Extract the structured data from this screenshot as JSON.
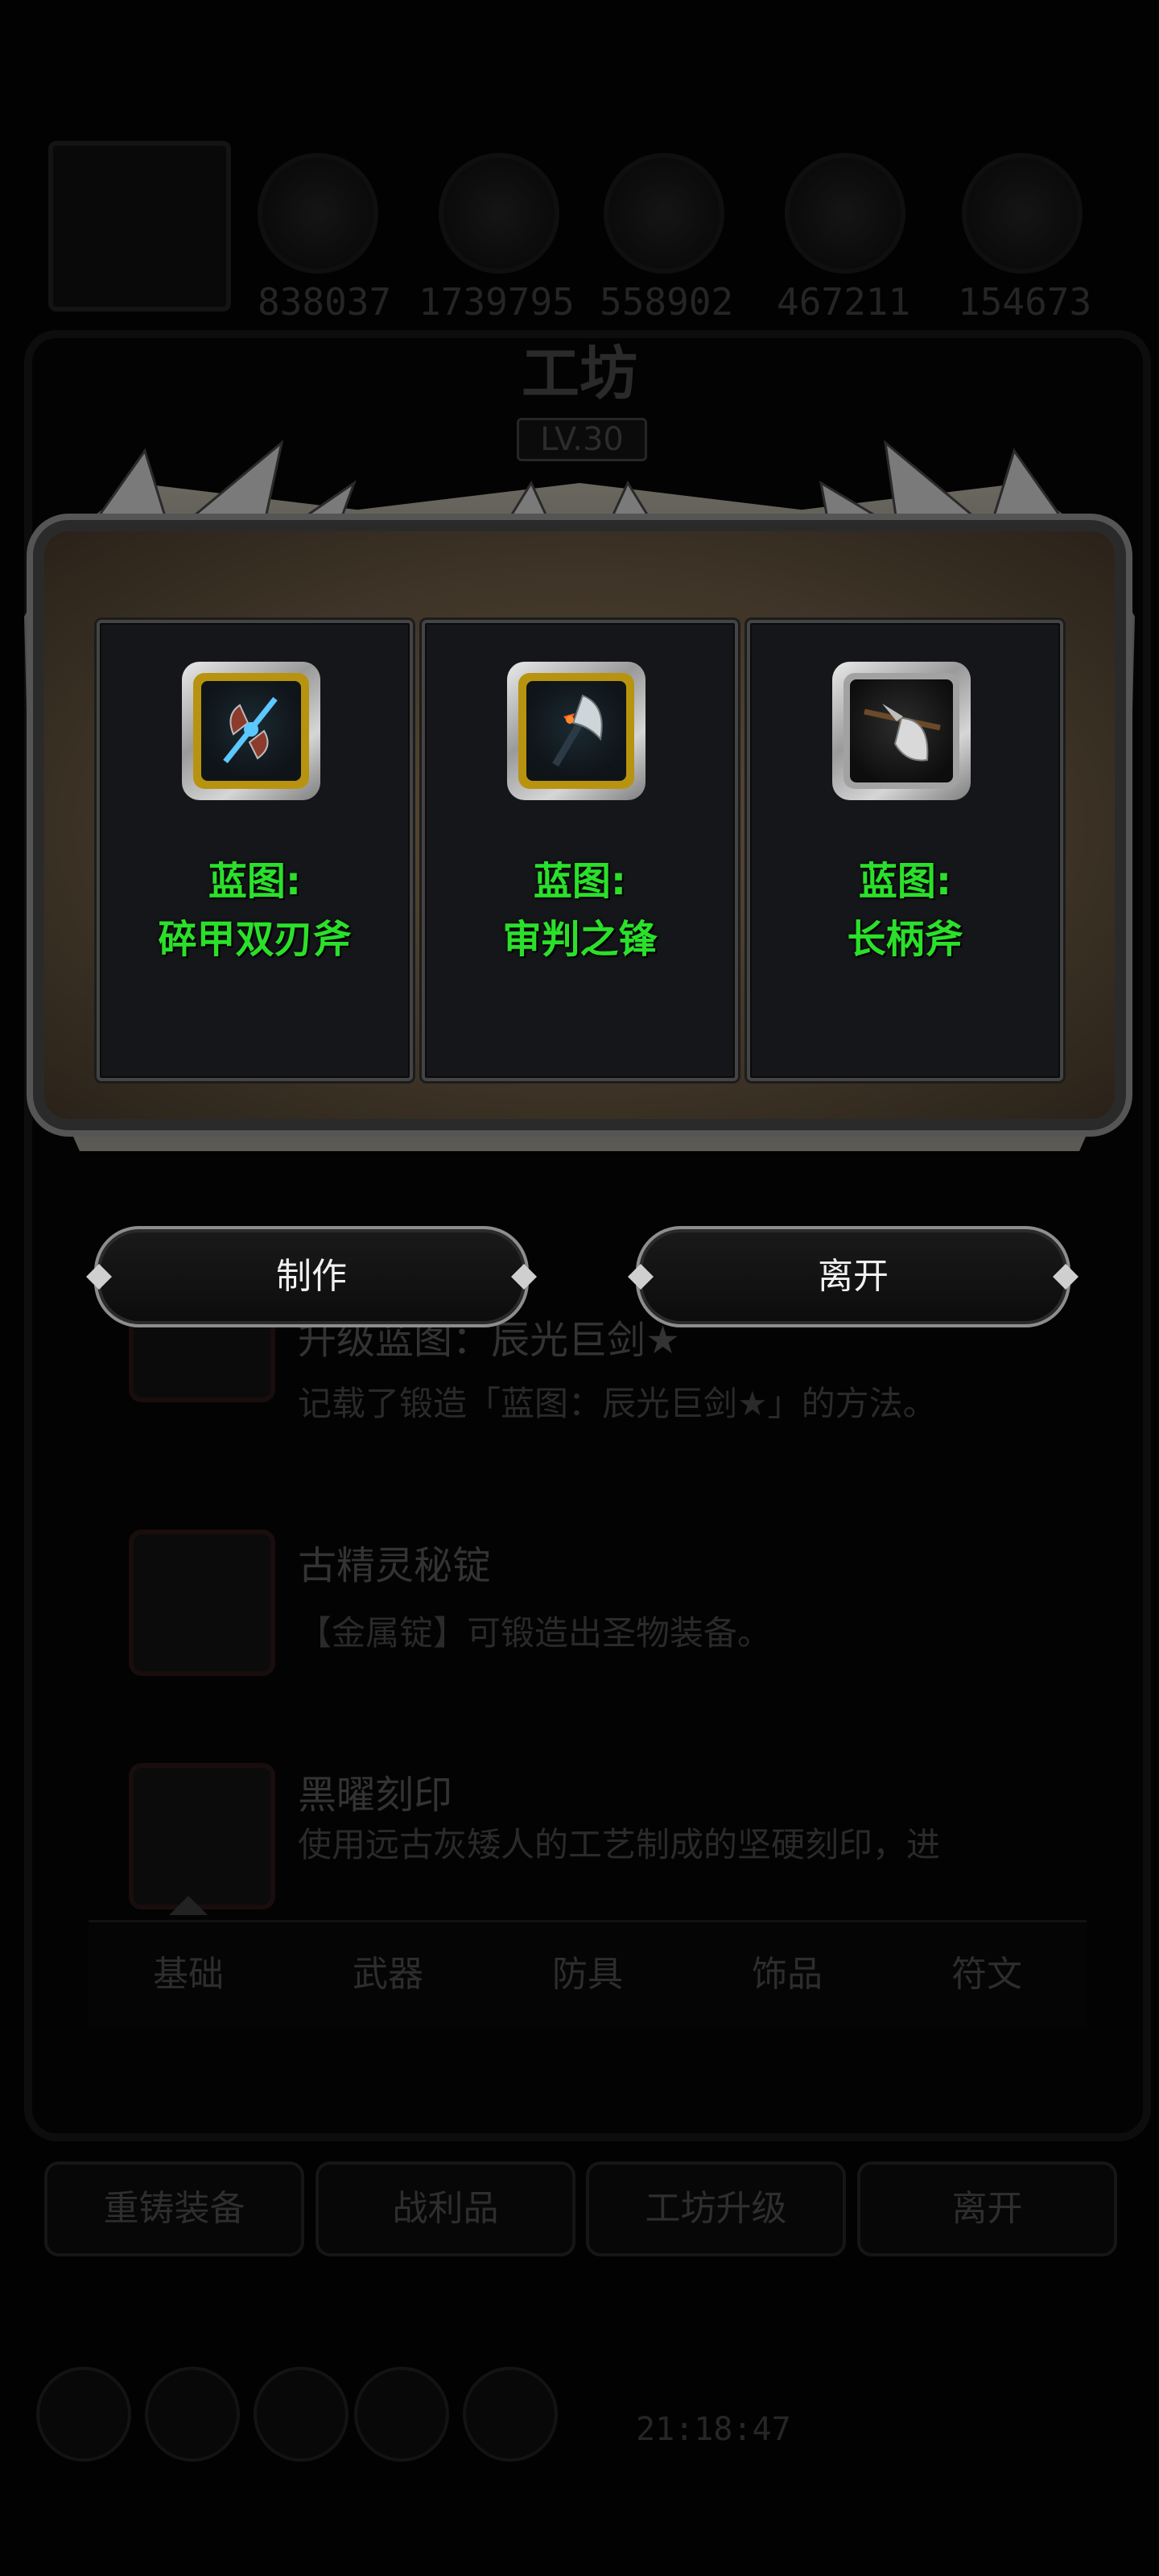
{
  "background": {
    "resources": [
      "838037",
      "1739795",
      "558902",
      "467211",
      "154673"
    ],
    "workshop_title": "工坊",
    "workshop_level": "LV.30",
    "list_items": [
      {
        "name": "升级蓝图：辰光巨剑★",
        "desc": "记载了锻造「蓝图：辰光巨剑★」的方法。"
      },
      {
        "name": "古精灵秘锭",
        "desc": "【金属锭】可锻造出圣物装备。"
      },
      {
        "name": "黑曜刻印",
        "desc": "使用远古灰矮人的工艺制成的坚硬刻印，进"
      }
    ],
    "tabs": [
      "基础",
      "武器",
      "防具",
      "饰品",
      "符文"
    ],
    "bottom_buttons": [
      "重铸装备",
      "战利品",
      "工坊升级",
      "离开"
    ],
    "clock": "21:18:47"
  },
  "modal": {
    "cards": [
      {
        "line1": "蓝图:",
        "line2": "碎甲双刃斧",
        "icon": "double-blade-axe-icon",
        "frame": "gold"
      },
      {
        "line1": "蓝图:",
        "line2": "审判之锋",
        "icon": "judgment-axe-icon",
        "frame": "gold"
      },
      {
        "line1": "蓝图:",
        "line2": "长柄斧",
        "icon": "halberd-axe-icon",
        "frame": "silver"
      }
    ],
    "craft_button": "制作",
    "leave_button": "离开",
    "label_color": "#2be02b"
  }
}
